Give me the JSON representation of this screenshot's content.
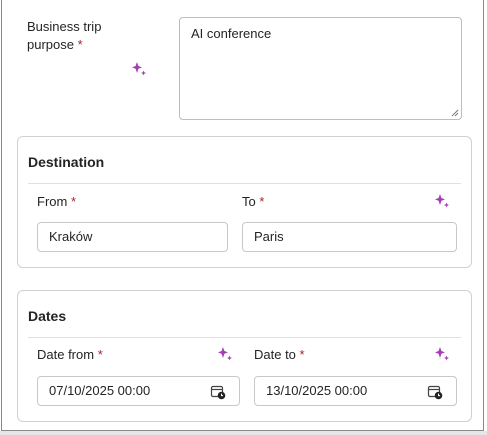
{
  "purpose": {
    "label": "Business trip purpose",
    "required_mark": "*",
    "value": "AI conference",
    "ai_icon": "sparkle-icon"
  },
  "destination": {
    "title": "Destination",
    "from": {
      "label": "From",
      "required_mark": "*",
      "value": "Kraków"
    },
    "to": {
      "label": "To",
      "required_mark": "*",
      "value": "Paris"
    },
    "ai_icon": "sparkle-icon"
  },
  "dates": {
    "title": "Dates",
    "date_from": {
      "label": "Date from",
      "required_mark": "*",
      "value": "07/10/2025 00:00",
      "icon": "calendar-clock-icon"
    },
    "date_to": {
      "label": "Date to",
      "required_mark": "*",
      "value": "13/10/2025 00:00",
      "icon": "calendar-clock-icon"
    },
    "ai_icon": "sparkle-icon"
  },
  "colors": {
    "required": "#a4262c",
    "ai_accent": "#a63ab8",
    "border": "#c8c8c8"
  }
}
